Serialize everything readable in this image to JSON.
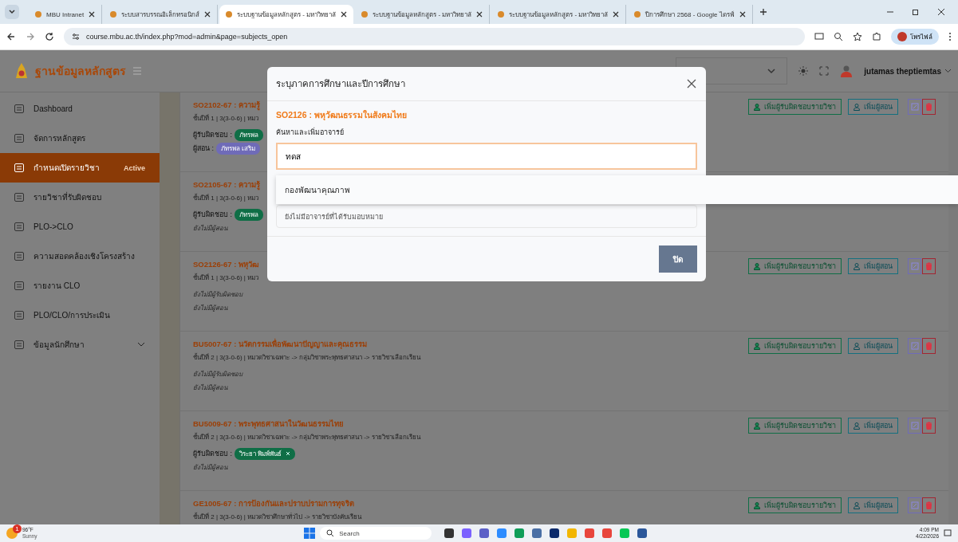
{
  "browser": {
    "tabs": [
      {
        "title": "MBU Intranet",
        "selected": false
      },
      {
        "title": "ระบบสารบรรณอิเล็กทรอนิกส์",
        "selected": false
      },
      {
        "title": "ระบบฐานข้อมูลหลักสูตร - มหาวิทยาลั",
        "selected": true
      },
      {
        "title": "ระบบฐานข้อมูลหลักสูตร - มหาวิทยาลั",
        "selected": false
      },
      {
        "title": "ระบบฐานข้อมูลหลักสูตร - มหาวิทยาลั",
        "selected": false
      },
      {
        "title": "ปีการศึกษา 2568 - Google ไดรฟ์",
        "selected": false
      }
    ],
    "url": "course.mbu.ac.th/index.php?mod=admin&page=subjects_open",
    "profile": "โพรไฟล์"
  },
  "app": {
    "brand": "ฐานข้อมูลหลักสูตร",
    "user": "jutamas theptiemtas"
  },
  "sidebar": {
    "items": [
      {
        "label": "Dashboard",
        "selected": false,
        "expandable": false
      },
      {
        "label": "จัดการหลักสูตร",
        "selected": false,
        "expandable": false
      },
      {
        "label": "กำหนดเปิดรายวิชา",
        "selected": true,
        "badge": "Active",
        "expandable": false
      },
      {
        "label": "รายวิชาที่รับผิดชอบ",
        "selected": false,
        "expandable": false
      },
      {
        "label": "PLO->CLO",
        "selected": false,
        "expandable": false
      },
      {
        "label": "ความสอดคล้องเชิงโครงสร้าง",
        "selected": false,
        "expandable": false
      },
      {
        "label": "รายงาน CLO",
        "selected": false,
        "expandable": false
      },
      {
        "label": "PLO/CLO/การประเมิน",
        "selected": false,
        "expandable": false
      },
      {
        "label": "ข้อมูลนักศึกษา",
        "selected": false,
        "expandable": true
      }
    ]
  },
  "courses": [
    {
      "title": "SO2102-67 : ความรู้",
      "info": "ชั้นปีที่ 1 | 3(3-0-6) | หมว",
      "actions": [
        "เพิ่มผู้รับผิดชอบรายวิชา",
        "เพิ่มผู้สอน"
      ],
      "lines": [
        {
          "kind": "tags",
          "label": "ผู้รับผิดชอบ :",
          "tags": [
            {
              "name": "ภัทรพล",
              "color": "#0f6e46",
              "removable": false
            }
          ]
        },
        {
          "kind": "tags",
          "label": "ผู้สอน :",
          "tags": [
            {
              "name": "ภัทรพล เสริม",
              "color": "#6f6bb8",
              "removable": false
            }
          ]
        }
      ]
    },
    {
      "title": "SO2105-67 : ความรู้",
      "info": "ชั้นปีที่ 1 | 3(3-0-6) | หมว",
      "lines": [
        {
          "kind": "tags",
          "label": "ผู้รับผิดชอบ :",
          "tags": [
            {
              "name": "ภัทรพล",
              "color": "#0f6e46",
              "removable": false
            }
          ]
        },
        {
          "kind": "empty",
          "text": "ยังไม่มีผู้สอน"
        }
      ]
    },
    {
      "title": "SO2126-67 : พหุวัฒ",
      "info": "ชั้นปีที่ 1 | 3(3-0-6) | หมว",
      "actions": [
        "เพิ่มผู้รับผิดชอบรายวิชา",
        "เพิ่มผู้สอน"
      ],
      "lines": [
        {
          "kind": "empty",
          "text": "ยังไม่มีผู้รับผิดชอบ"
        },
        {
          "kind": "empty",
          "text": "ยังไม่มีผู้สอน"
        }
      ]
    },
    {
      "title": "BU5007-67 : นวัตกรรมเพื่อพัฒนาปัญญาและคุณธรรม",
      "info": "ชั้นปีที่ 2 | 3(3-0-6) | หมวดวิชาเฉพาะ -> กลุ่มวิชาพระพุทธศาสนา -> รายวิชาเลือกเรียน",
      "actions": [
        "เพิ่มผู้รับผิดชอบรายวิชา",
        "เพิ่มผู้สอน"
      ],
      "lines": [
        {
          "kind": "empty",
          "text": "ยังไม่มีผู้รับผิดชอบ"
        },
        {
          "kind": "empty",
          "text": "ยังไม่มีผู้สอน"
        }
      ]
    },
    {
      "title": "BU5009-67 : พระพุทธศาสนาในวัฒนธรรมไทย",
      "info": "ชั้นปีที่ 2 | 3(3-0-6) | หมวดวิชาเฉพาะ -> กลุ่มวิชาพระพุทธศาสนา -> รายวิชาเลือกเรียน",
      "actions": [
        "เพิ่มผู้รับผิดชอบรายวิชา",
        "เพิ่มผู้สอน"
      ],
      "lines": [
        {
          "kind": "tags",
          "label": "ผู้รับผิดชอบ :",
          "tags": [
            {
              "name": "วิระยา พิมพ์พันธ์",
              "color": "#0f6e46",
              "removable": true
            }
          ]
        },
        {
          "kind": "empty",
          "text": "ยังไม่มีผู้สอน"
        }
      ]
    },
    {
      "title": "GE1005-67 : การป้องกันและปราบปรามการทุจริต",
      "info": "ชั้นปีที่ 2 | 3(3-0-6) | หมวดวิชาศึกษาทั่วไป -> รายวิชาบังคับเรียน",
      "actions": [
        "เพิ่มผู้รับผิดชอบรายวิชา",
        "เพิ่มผู้สอน"
      ]
    }
  ],
  "modal": {
    "title": "ระบุภาคการศึกษาและปีการศึกษา",
    "subject": "SO2126 : พหุวัฒนธรรมในสังคมไทย",
    "search_label": "ค้นหาและเพิ่มอาจารย์",
    "search_value": "ทดส",
    "suggestions": [
      "กองพัฒนาคุณภาพ"
    ],
    "assigned_empty": "ยังไม่มีอาจารย์ที่ได้รับมอบหมาย",
    "close_button": "ปิด"
  },
  "taskbar": {
    "temperature": "96°F",
    "weather": "Sunny",
    "weather_badge": "1",
    "search_placeholder": "Search",
    "time": "4:09 PM",
    "date": "4/22/2026"
  }
}
